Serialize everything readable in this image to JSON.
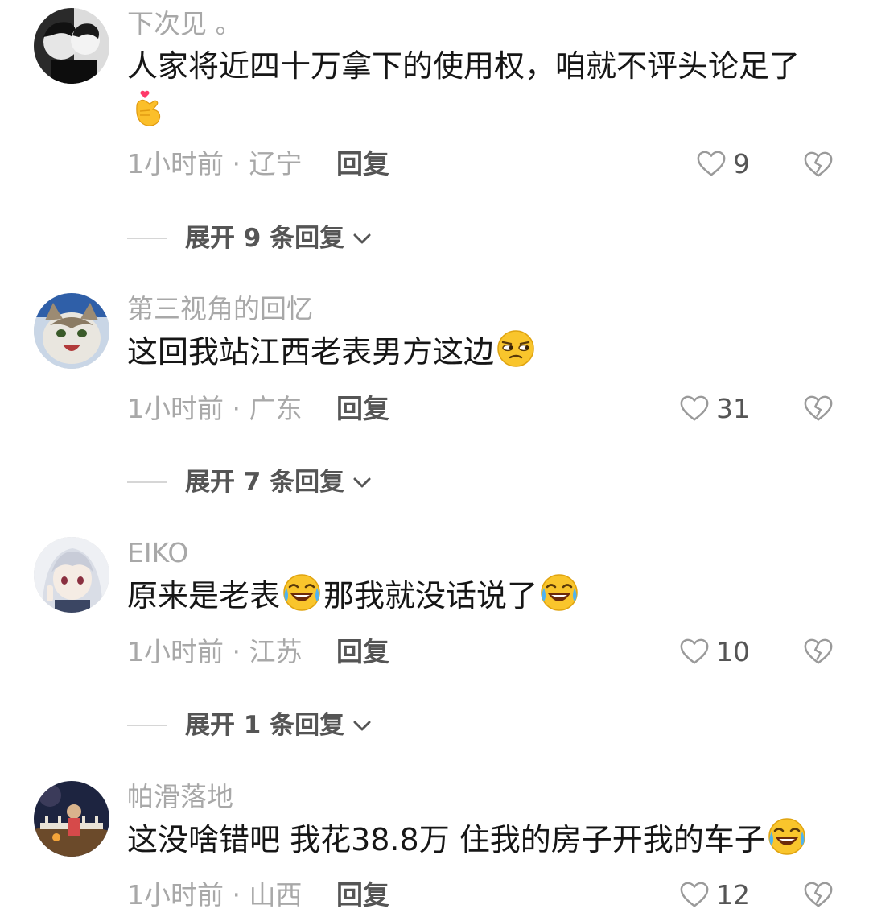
{
  "comments": [
    {
      "username": "下次见 。",
      "text_parts": [
        "人家将近四十万拿下的使用权，咱就不评头论足了"
      ],
      "time_location": "1小时前 · 辽宁",
      "reply_label": "回复",
      "likes": "9",
      "expand_label": "展开 9 条回复"
    },
    {
      "username": "第三视角的回忆",
      "text_parts": [
        "这回我站江西老表男方这边"
      ],
      "time_location": "1小时前 · 广东",
      "reply_label": "回复",
      "likes": "31",
      "expand_label": "展开 7 条回复"
    },
    {
      "username": "EIKO",
      "text_parts": [
        "原来是老表",
        "那我就没话说了"
      ],
      "time_location": "1小时前 · 江苏",
      "reply_label": "回复",
      "likes": "10",
      "expand_label": "展开 1 条回复"
    },
    {
      "username": "帕滑落地",
      "text_parts": [
        "这没啥错吧 我花38.8万 住我的房子开我的车子"
      ],
      "time_location": "1小时前 · 山西",
      "reply_label": "回复",
      "likes": "12"
    }
  ],
  "icons": {
    "like": "heart-outline-icon",
    "dislike": "broken-heart-icon",
    "expand": "chevron-down-icon",
    "emoji_finger_heart": "finger-heart-emoji",
    "emoji_side_eye": "side-eye-emoji",
    "emoji_laughing_crying": "rolling-laughing-emoji"
  },
  "colors": {
    "text": "#161616",
    "muted": "#a8a8a8",
    "secondary": "#555555"
  }
}
